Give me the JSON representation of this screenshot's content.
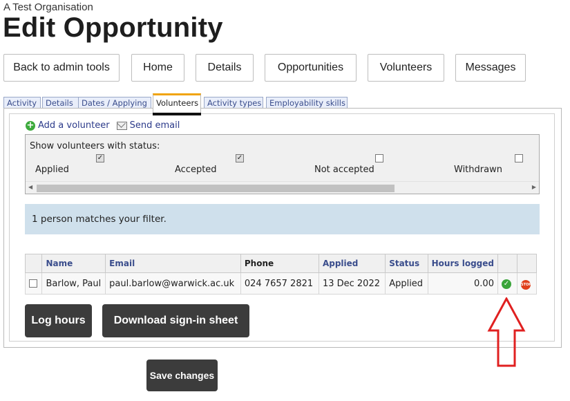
{
  "organisation": "A Test Organisation",
  "title": "Edit Opportunity",
  "nav": [
    "Back to admin tools",
    "Home",
    "Details",
    "Opportunities",
    "Volunteers",
    "Messages"
  ],
  "tabs": [
    "Activity",
    "Details",
    "Dates / Applying",
    "Volunteers",
    "Activity types",
    "Employability skills"
  ],
  "active_tab": "Volunteers",
  "actions": {
    "add": "Add a volunteer",
    "email": "Send email"
  },
  "filter": {
    "label": "Show volunteers with status:",
    "statuses": [
      {
        "label": "Applied",
        "checked": true
      },
      {
        "label": "Accepted",
        "checked": true
      },
      {
        "label": "Not accepted",
        "checked": false
      },
      {
        "label": "Withdrawn",
        "checked": false
      }
    ]
  },
  "match_text": "1 person matches your filter.",
  "table": {
    "headers": [
      "Name",
      "Email",
      "Phone",
      "Applied",
      "Status",
      "Hours logged"
    ],
    "rows": [
      {
        "name": "Barlow, Paul",
        "email": "paul.barlow@warwick.ac.uk",
        "phone": "024 7657 2821",
        "applied": "13 Dec 2022",
        "status": "Applied",
        "hours": "0.00"
      }
    ],
    "stop_icon_text": "STOP"
  },
  "buttons": {
    "log_hours": "Log hours",
    "download": "Download sign-in sheet",
    "save": "Save changes"
  },
  "colors": {
    "accent_tab": "#f0a30a",
    "match_bar": "#cfe0ec",
    "link": "#3a4d8c",
    "arrow": "#e02020",
    "dark_button": "#3c3c3c"
  }
}
